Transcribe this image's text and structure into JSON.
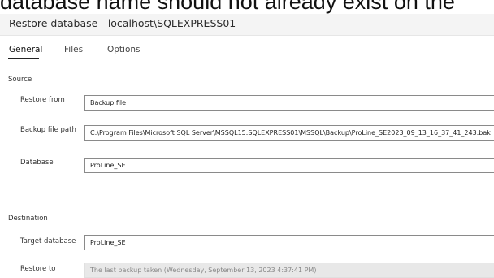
{
  "background_text": "database name should not already exist on the",
  "window": {
    "title": "Restore database - localhost\\SQLEXPRESS01"
  },
  "tabs": [
    {
      "label": "General",
      "active": true
    },
    {
      "label": "Files",
      "active": false
    },
    {
      "label": "Options",
      "active": false
    }
  ],
  "source": {
    "heading": "Source",
    "restore_from": {
      "label": "Restore from",
      "value": "Backup file"
    },
    "backup_file_path": {
      "label": "Backup file path",
      "value": "C:\\Program Files\\Microsoft SQL Server\\MSSQL15.SQLEXPRESS01\\MSSQL\\Backup\\ProLine_SE2023_09_13_16_37_41_243.bak"
    },
    "database": {
      "label": "Database",
      "value": "ProLine_SE"
    }
  },
  "destination": {
    "heading": "Destination",
    "target_database": {
      "label": "Target database",
      "value": "ProLine_SE"
    },
    "restore_to": {
      "label": "Restore to",
      "value": "The last backup taken (Wednesday, September 13, 2023 4:37:41 PM)"
    }
  },
  "colors": {
    "accent": "#222222",
    "titlebar_bg": "#f4f4f4",
    "field_border": "#8a8a8a",
    "disabled_bg": "#e8e8e8"
  }
}
